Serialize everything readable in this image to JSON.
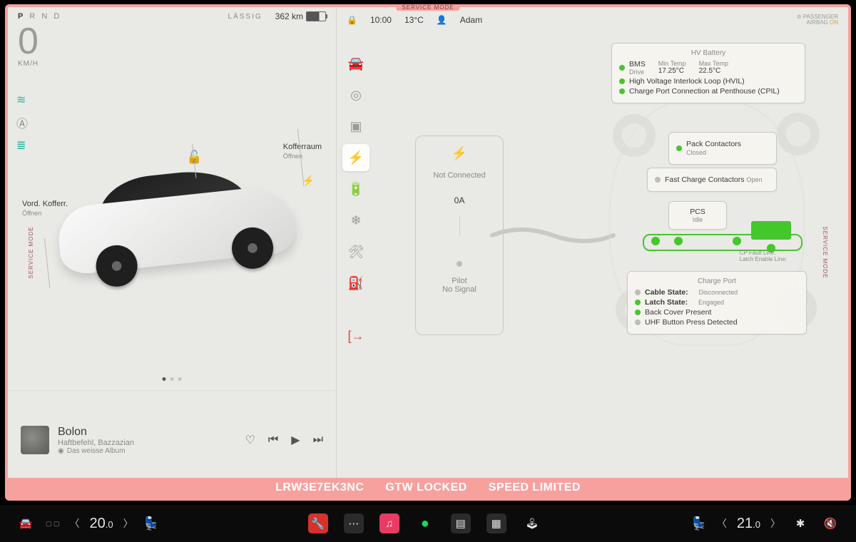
{
  "service_mode_label": "SERVICE MODE",
  "passenger_airbag": {
    "label": "PASSENGER",
    "sub": "AIRBAG",
    "state": "ON"
  },
  "left": {
    "gear_letters": "P R N D",
    "profile": "LÄSSIG",
    "range": "362 km",
    "speed_value": "0",
    "speed_unit": "KM/H",
    "frunk": {
      "title": "Vord. Kofferr.",
      "action": "Öffnen"
    },
    "trunk": {
      "title": "Kofferraum",
      "action": "Öffnen"
    }
  },
  "header": {
    "time": "10:00",
    "outside_temp": "13°C",
    "user": "Adam"
  },
  "connector": {
    "status": "Not Connected",
    "current": "0A",
    "pilot_label": "Pilot",
    "pilot_state": "No Signal"
  },
  "hv_battery": {
    "title": "HV Battery",
    "bms_label": "BMS",
    "bms_state": "Drive",
    "min_temp_label": "Min Temp",
    "min_temp": "17.25°C",
    "max_temp_label": "Max Temp",
    "max_temp": "22.5°C",
    "hvil": "High Voltage Interlock Loop (HVIL)",
    "cpil": "Charge Port Connection at Penthouse (CPIL)"
  },
  "contactors": {
    "pack": "Pack Contactors",
    "pack_state": "Closed",
    "fast": "Fast Charge Contactors",
    "fast_state": "Open",
    "pcs": "PCS",
    "pcs_state": "Idle",
    "cp_fault": "CP Fault Line:",
    "latch_enable": "Latch Enable Line:"
  },
  "charge_port": {
    "title": "Charge Port",
    "cable_lab": "Cable State:",
    "cable_val": "Disconnected",
    "latch_lab": "Latch State:",
    "latch_val": "Engaged",
    "back_cover": "Back Cover Present",
    "uhf": "UHF Button Press Detected"
  },
  "media": {
    "title": "Bolon",
    "artist": "Haftbefehl, Bazzazian",
    "album": "Das weisse Album"
  },
  "banner": {
    "vin": "LRW3E7EK3NC",
    "gtw": "GTW LOCKED",
    "speed_limited": "SPEED LIMITED"
  },
  "dock": {
    "left_temp": "20",
    "left_dec": ".0",
    "right_temp": "21",
    "right_dec": ".0"
  },
  "icons": {
    "lock": "🔓",
    "bolt": "⚡",
    "car": "🚗",
    "wheel": "☸",
    "chip": "⌗",
    "batt": "▭",
    "snow": "❄",
    "wrench": "🔧",
    "fuel": "⛽",
    "exit": "↪",
    "heart": "♡",
    "prev": "⏮",
    "play": "▶",
    "next": "⏭",
    "user": "👤",
    "lockclosed": "🔒",
    "music": "♫",
    "dots": "⋯",
    "spotify": "●",
    "radio": "▤",
    "dash": "▦",
    "joy": "🕹",
    "vol": "🔇",
    "fan": "✱",
    "seat": "💺",
    "lowbeam": "≋",
    "autohigh": "Ⓐ",
    "foglight": "≣"
  }
}
